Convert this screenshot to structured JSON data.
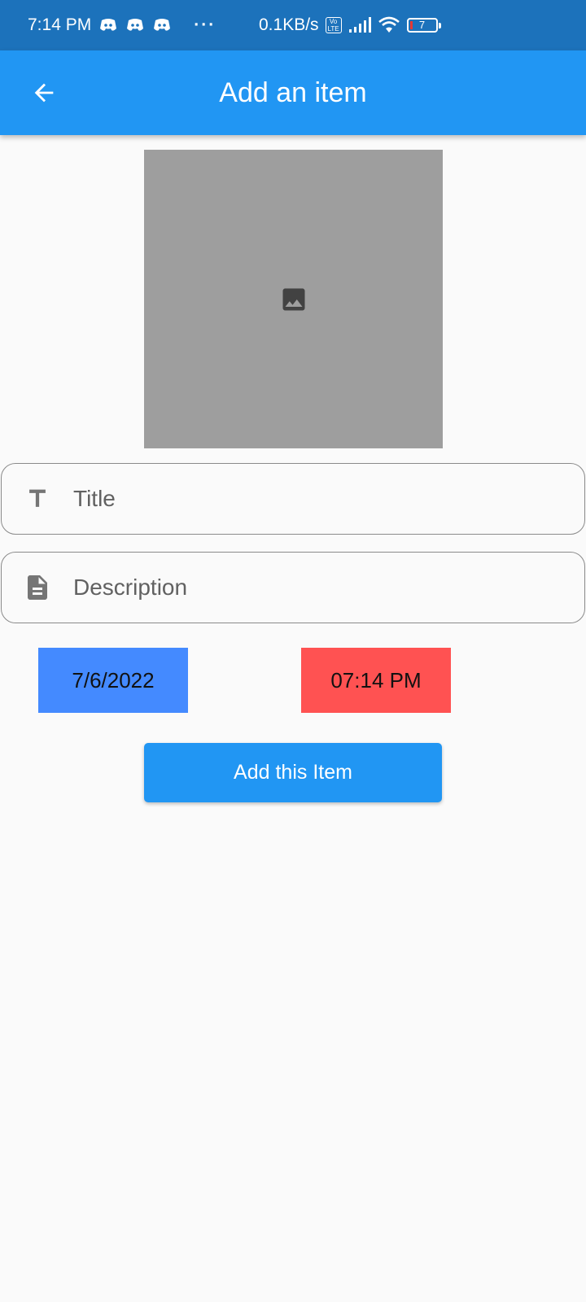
{
  "status_bar": {
    "time": "7:14 PM",
    "dots": "···",
    "network_speed": "0.1KB/s",
    "volte": "Vo LTE",
    "battery": "7",
    "notification_icons": [
      "discord-icon",
      "discord-icon",
      "discord-icon"
    ],
    "icons": [
      "signal-icon",
      "wifi-icon",
      "battery-icon"
    ]
  },
  "app_bar": {
    "title": "Add an item",
    "back_icon": "arrow-back-icon",
    "color": "#2196f3"
  },
  "image_picker": {
    "icon": "image-icon",
    "color": "#9e9e9e"
  },
  "form": {
    "title_field": {
      "placeholder": "Title",
      "icon": "title-icon"
    },
    "description_field": {
      "placeholder": "Description",
      "icon": "description-icon"
    }
  },
  "date_time": {
    "date": "7/6/2022",
    "date_color": "#448aff",
    "time": "07:14 PM",
    "time_color": "#ff5252"
  },
  "submit": {
    "label": "Add this Item",
    "color": "#2196f3"
  }
}
